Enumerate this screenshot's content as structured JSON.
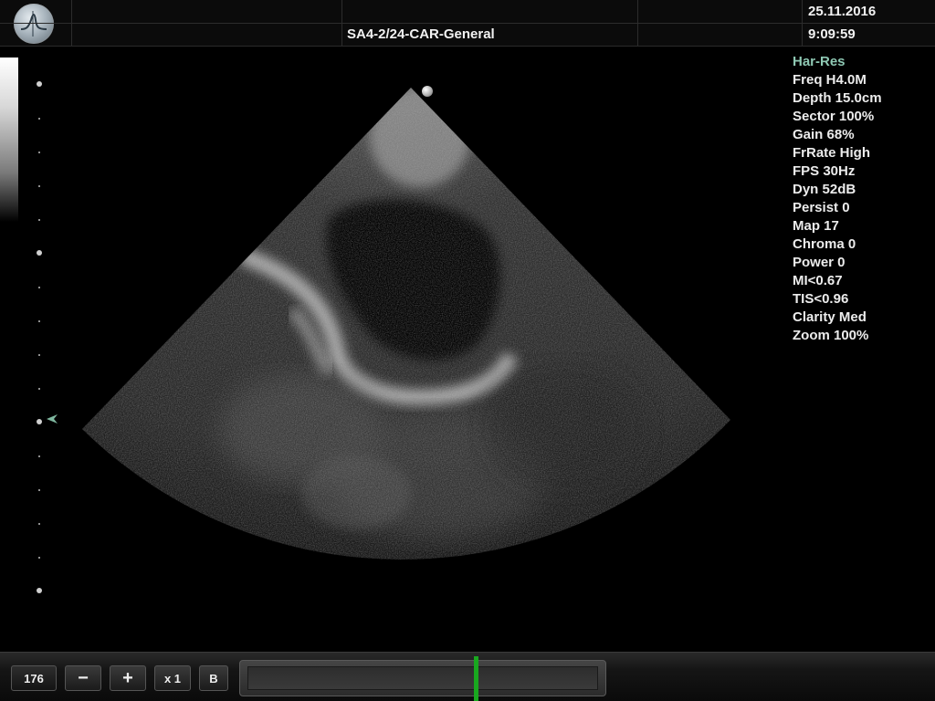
{
  "header": {
    "logo_icon": "waveform-logo-icon",
    "preset": "SA4-2/24-CAR-General",
    "date": "25.11.2016",
    "time": "9:09:59"
  },
  "parameters": [
    {
      "label": "Har-Res",
      "mode": true
    },
    {
      "label": "Freq H4.0M"
    },
    {
      "label": "Depth 15.0cm"
    },
    {
      "label": "Sector 100%"
    },
    {
      "label": "Gain 68%"
    },
    {
      "label": "FrRate High"
    },
    {
      "label": "FPS 30Hz"
    },
    {
      "label": "Dyn 52dB"
    },
    {
      "label": "Persist 0"
    },
    {
      "label": "Map 17"
    },
    {
      "label": "Chroma 0"
    },
    {
      "label": "Power 0"
    },
    {
      "label": "MI<0.67"
    },
    {
      "label": "TIS<0.96"
    },
    {
      "label": "Clarity Med"
    },
    {
      "label": "Zoom 100%"
    }
  ],
  "colors": {
    "mode_text": "#8fc9b4",
    "text": "#ececec",
    "cine_cursor": "#19a81f",
    "focus_marker": "#7fb8a0"
  },
  "image": {
    "type": "cardiac-ultrasound-sector",
    "focus_icon": "focus-arrow-icon",
    "orientation_icon": "orientation-dot-icon"
  },
  "controls": {
    "frame_value": "176",
    "minus_label": "−",
    "plus_label": "+",
    "speed_label": "x 1",
    "b_label": "B"
  },
  "cine": {
    "position": 0.65
  }
}
